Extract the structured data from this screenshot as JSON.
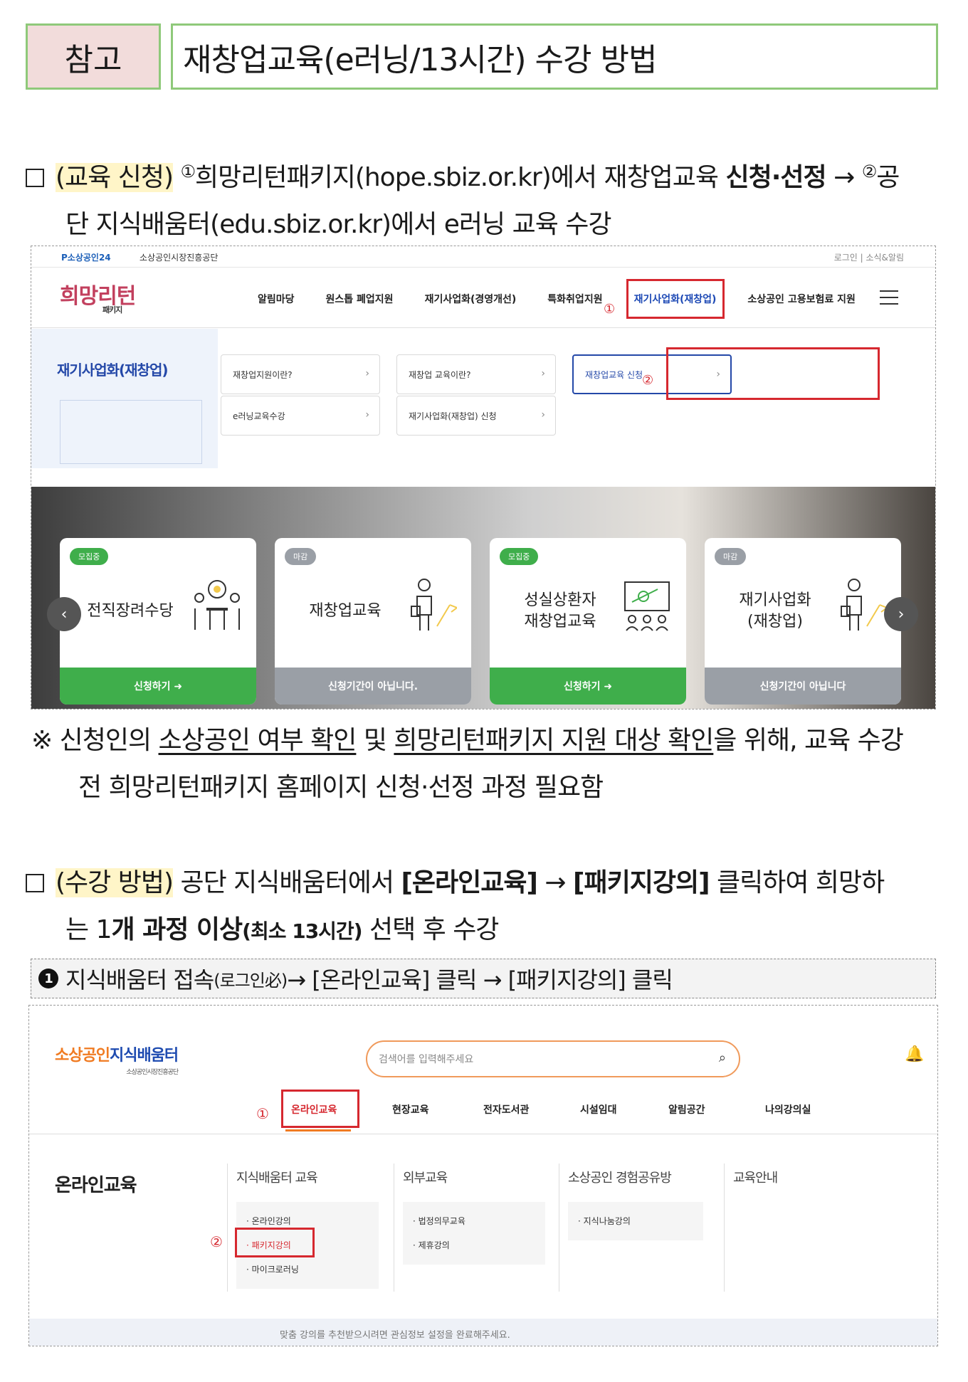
{
  "header": {
    "ref_label": "참고",
    "title": "재창업교육(e러닝/13시간) 수강 방법"
  },
  "section1": {
    "tag": "(교육 신청)",
    "c1": "①",
    "t1": "희망리턴패키지(hope.sbiz.or.kr)에서 재창업교육 ",
    "b1": "신청·선정",
    "arrow": " → ",
    "c2": "②",
    "t2": "공",
    "line2": "단 지식배움터(edu.sbiz.or.kr)에서 e러닝 교육 수강"
  },
  "shot1": {
    "topbar_left1": "P소상공인24",
    "topbar_left2": "소상공인시장진흥공단",
    "topbar_right": "로그인 | 소식&알림",
    "logo": "희망리턴",
    "logo_sub": "패키지",
    "nav": [
      "알림마당",
      "원스톱 폐업지원",
      "재기사업화(경영개선)",
      "특화취업지원",
      "재기사업화(재창업)",
      "소상공인 고용보험료 지원"
    ],
    "circle1": "①",
    "circle2": "②",
    "left_title": "재기사업화(재창업)",
    "buttons": [
      "재창업지원이란?",
      "재창업 교육이란?",
      "재창업교육 신청",
      "e러닝교육수강",
      "재기사업화(재창업) 신청"
    ],
    "chev": "›",
    "cards": [
      {
        "badge": "모집중",
        "title1": "전직장려수당",
        "title2": "",
        "footer": "신청하기 ➜"
      },
      {
        "badge": "마감",
        "title1": "재창업교육",
        "title2": "",
        "footer": "신청기간이 아닙니다."
      },
      {
        "badge": "모집중",
        "title1": "성실상환자",
        "title2": "재창업교육",
        "footer": "신청하기 ➜"
      },
      {
        "badge": "마감",
        "title1": "재기사업화",
        "title2": "(재창업)",
        "footer": "신청기간이 아닙니다"
      }
    ],
    "arrow_left": "‹",
    "arrow_right": "›",
    "colors": {
      "green": "#3fae4b",
      "gray": "#9a9fa6",
      "navy": "#2448a8",
      "red": "#d6282f"
    }
  },
  "note": {
    "mark": "※ 신청인의 ",
    "u1": "소상공인 여부 확인",
    "mid": " 및 ",
    "u2": "희망리턴패키지 지원 대상 확인",
    "end": "을 위해, 교육 수강",
    "line2": "전 희망리턴패키지 홈페이지 신청·선정 과정 필요함"
  },
  "section2": {
    "tag": "(수강 방법)",
    "t1": " 공단 지식배움터에서 ",
    "b1": "[온라인교육]",
    "arrow": " → ",
    "b2": "[패키지강의]",
    "t2": " 클릭하여 희망하",
    "l2a": "는 1",
    "l2b": "개 과정 이상",
    "l2c": "(최소 13시간)",
    "l2d": " 선택 후 수강"
  },
  "step": {
    "num": "1",
    "t1": "지식배움터 접속",
    "t2": "(로그인必)",
    "t3": " → [온라인교육] 클릭 → [패키지강의] 클릭"
  },
  "shot2": {
    "logo_orange": "소상공인",
    "logo_blue": "지식배움터",
    "logo_sub": "소상공인시장진흥공단",
    "search_placeholder": "검색어를 입력해주세요",
    "search_icon": "⌕",
    "bell": "🔔",
    "circle1": "①",
    "circle2": "②",
    "nav": [
      "온라인교육",
      "현장교육",
      "전자도서관",
      "시설임대",
      "알림공간",
      "나의강의실"
    ],
    "section_title": "온라인교육",
    "cols": [
      {
        "head": "지식배움터 교육",
        "items": [
          "· 온라인강의",
          "· 패키지강의",
          "· 마이크로러닝"
        ]
      },
      {
        "head": "외부교육",
        "items": [
          "· 법정의무교육",
          "· 제휴강의"
        ]
      },
      {
        "head": "소상공인 경험공유방",
        "items": [
          "· 지식나눔강의"
        ]
      },
      {
        "head": "교육안내",
        "items": []
      }
    ],
    "bottom_text": "맞춤 강의를 추천받으시려면 관심정보 설정을 완료해주세요."
  }
}
